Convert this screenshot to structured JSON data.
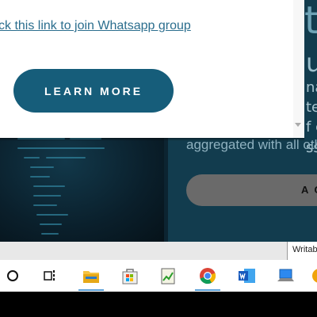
{
  "popup": {
    "link_text": "ck this link to join Whatsapp group",
    "learn_more": "LEARN MORE"
  },
  "background": {
    "peek_letter": "t",
    "peek_us": "us",
    "peek_lines": [
      "na",
      "te",
      "f c",
      "ss"
    ],
    "aggregated_text": "aggregated with all oth",
    "accept_label": "A C"
  },
  "statusbar": {
    "writable": "Writab"
  },
  "taskbar": {
    "items": [
      {
        "name": "cortana-circle-icon"
      },
      {
        "name": "task-view-icon"
      },
      {
        "name": "file-explorer-icon",
        "active": true
      },
      {
        "name": "microsoft-store-icon"
      },
      {
        "name": "notepad-chart-icon"
      },
      {
        "name": "chrome-icon",
        "active": true
      },
      {
        "name": "word-icon"
      },
      {
        "name": "laptop-app-icon"
      }
    ]
  },
  "colors": {
    "accent": "#165d7a",
    "link": "#2b6e8e",
    "dark_bg": "#0c2431"
  }
}
